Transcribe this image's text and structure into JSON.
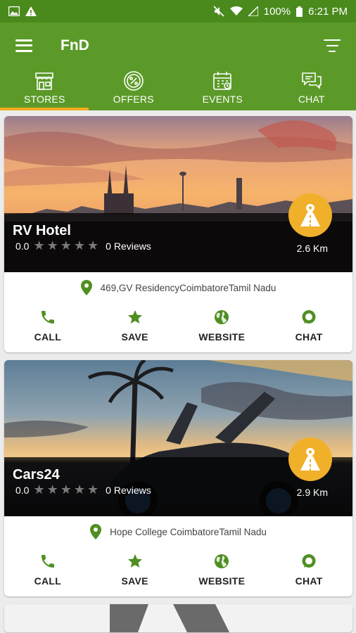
{
  "status": {
    "battery": "100%",
    "time": "6:21 PM",
    "icons": [
      "image-icon",
      "alert-icon",
      "mute-icon",
      "wifi-icon",
      "signal-icon",
      "battery-icon"
    ]
  },
  "appbar": {
    "title": "FnD",
    "menu_icon": "hamburger-icon",
    "filter_icon": "filter-icon"
  },
  "tabs": [
    {
      "label": "STORES",
      "icon": "store-icon",
      "active": true
    },
    {
      "label": "OFFERS",
      "icon": "percent-badge-icon",
      "active": false
    },
    {
      "label": "EVENTS",
      "icon": "calendar-icon",
      "active": false
    },
    {
      "label": "CHAT",
      "icon": "chat-bubbles-icon",
      "active": false
    }
  ],
  "colors": {
    "primary": "#5b9a28",
    "primary_dark": "#4a8a1d",
    "accent": "#f2a91c",
    "badge": "#f0b02a",
    "icon_green": "#4f8f22"
  },
  "stores": [
    {
      "name": "RV Hotel",
      "rating": "0.0",
      "stars_filled": 0,
      "stars_total": 5,
      "reviews": "0 Reviews",
      "distance": "2.6 Km",
      "address": "469,GV ResidencyCoimbatoreTamil Nadu",
      "image": "city-skyline-sunset"
    },
    {
      "name": "Cars24",
      "rating": "0.0",
      "stars_filled": 0,
      "stars_total": 5,
      "reviews": "0 Reviews",
      "distance": "2.9 Km",
      "address": "Hope College CoimbatoreTamil Nadu",
      "image": "sports-car-sunset"
    }
  ],
  "actions": {
    "call": "CALL",
    "save": "SAVE",
    "website": "WEBSITE",
    "chat": "CHAT"
  }
}
